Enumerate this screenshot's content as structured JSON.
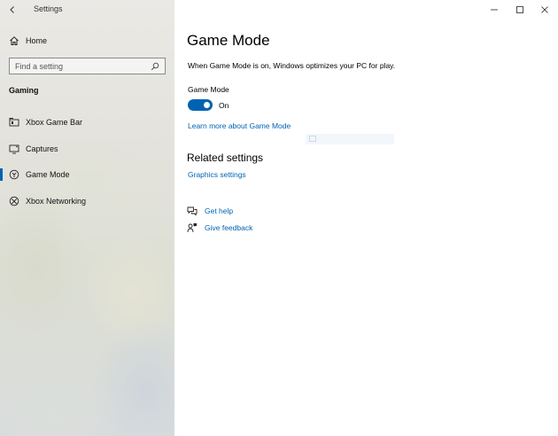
{
  "window": {
    "title": "Settings"
  },
  "sidebar": {
    "home_label": "Home",
    "search_placeholder": "Find a setting",
    "section_label": "Gaming",
    "items": [
      {
        "label": "Xbox Game Bar",
        "icon": "xbox-game-bar-icon",
        "selected": false
      },
      {
        "label": "Captures",
        "icon": "captures-icon",
        "selected": false
      },
      {
        "label": "Game Mode",
        "icon": "game-mode-icon",
        "selected": true
      },
      {
        "label": "Xbox Networking",
        "icon": "xbox-icon",
        "selected": false
      }
    ]
  },
  "main": {
    "title": "Game Mode",
    "description": "When Game Mode is on, Windows optimizes your PC for play.",
    "toggle": {
      "label": "Game Mode",
      "state_text": "On",
      "checked": true
    },
    "learn_more_link": "Learn more about Game Mode",
    "related_title": "Related settings",
    "graphics_link": "Graphics settings",
    "help": {
      "get_help": "Get help",
      "give_feedback": "Give feedback"
    }
  },
  "colors": {
    "accent": "#0063b1",
    "link": "#0063b1"
  }
}
